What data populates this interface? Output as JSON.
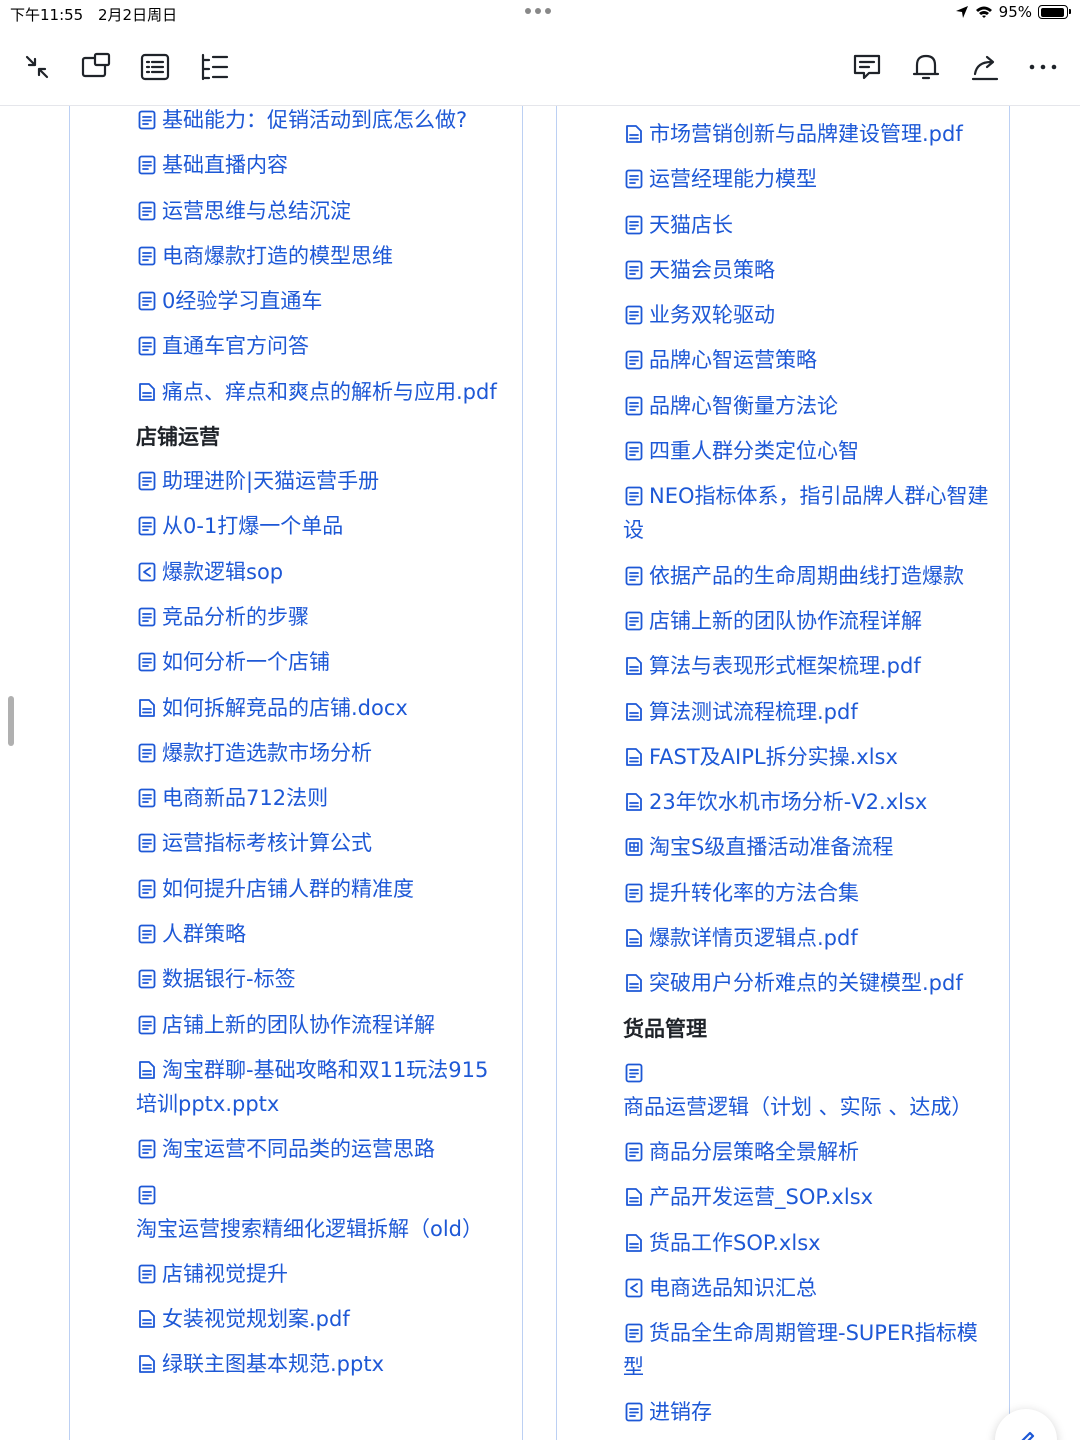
{
  "status": {
    "time": "下午11:55",
    "date": "2月2日周日",
    "battery": "95%",
    "battery_level": 0.95
  },
  "toolbar": {
    "left_icons": [
      "collapse-icon",
      "window-icon",
      "list-view-icon",
      "outline-icon"
    ],
    "right_icons": [
      "comment-icon",
      "bell-icon",
      "share-icon",
      "more-icon"
    ]
  },
  "left_column": {
    "items_top": [
      {
        "label": "基础能力：促销活动到底怎么做?",
        "icon": "doc-icon"
      },
      {
        "label": "基础直播内容",
        "icon": "doc-icon"
      },
      {
        "label": "运营思维与总结沉淀",
        "icon": "doc-icon"
      },
      {
        "label": "电商爆款打造的模型思维",
        "icon": "doc-icon"
      },
      {
        "label": "0经验学习直通车",
        "icon": "doc-icon"
      },
      {
        "label": "直通车官方问答",
        "icon": "doc-icon"
      },
      {
        "label": "痛点、痒点和爽点的解析与应用.pdf",
        "icon": "file-icon"
      }
    ],
    "section_title": "店铺运营",
    "items_section": [
      {
        "label": "助理进阶|天猫运营手册",
        "icon": "doc-icon"
      },
      {
        "label": "从0-1打爆一个单品",
        "icon": "doc-icon"
      },
      {
        "label": "爆款逻辑sop",
        "icon": "mindmap-icon"
      },
      {
        "label": "竞品分析的步骤",
        "icon": "doc-icon"
      },
      {
        "label": "如何分析一个店铺",
        "icon": "doc-icon"
      },
      {
        "label": "如何拆解竞品的店铺.docx",
        "icon": "file-icon"
      },
      {
        "label": "爆款打造选款市场分析",
        "icon": "doc-icon"
      },
      {
        "label": "电商新品712法则",
        "icon": "doc-icon"
      },
      {
        "label": "运营指标考核计算公式",
        "icon": "doc-icon"
      },
      {
        "label": "如何提升店铺人群的精准度",
        "icon": "doc-icon"
      },
      {
        "label": "人群策略",
        "icon": "doc-icon"
      },
      {
        "label": "数据银行-标签",
        "icon": "doc-icon"
      },
      {
        "label": "店铺上新的团队协作流程详解",
        "icon": "doc-icon"
      },
      {
        "label": "淘宝群聊-基础攻略和双11玩法915培训pptx.pptx",
        "icon": "file-icon"
      },
      {
        "label": "淘宝运营不同品类的运营思路",
        "icon": "doc-icon"
      },
      {
        "label": "淘宝运营搜索精细化逻辑拆解（old）",
        "icon": "doc-icon"
      },
      {
        "label": "店铺视觉提升",
        "icon": "doc-icon"
      },
      {
        "label": "女装视觉规划案.pdf",
        "icon": "file-icon"
      },
      {
        "label": "绿联主图基本规范.pptx",
        "icon": "file-icon"
      }
    ]
  },
  "right_column": {
    "items_top": [
      {
        "label": "市场营销创新与品牌建设管理.pdf",
        "icon": "file-icon"
      },
      {
        "label": "运营经理能力模型",
        "icon": "doc-icon"
      },
      {
        "label": "天猫店长",
        "icon": "doc-icon"
      },
      {
        "label": "天猫会员策略",
        "icon": "doc-icon"
      },
      {
        "label": "业务双轮驱动",
        "icon": "doc-icon"
      },
      {
        "label": "品牌心智运营策略",
        "icon": "doc-icon"
      },
      {
        "label": "品牌心智衡量方法论",
        "icon": "doc-icon"
      },
      {
        "label": "四重人群分类定位心智",
        "icon": "doc-icon"
      },
      {
        "label": "NEO指标体系，指引品牌人群心智建设",
        "icon": "doc-icon"
      },
      {
        "label": "依据产品的生命周期曲线打造爆款",
        "icon": "doc-icon"
      },
      {
        "label": "店铺上新的团队协作流程详解",
        "icon": "doc-icon"
      },
      {
        "label": "算法与表现形式框架梳理.pdf",
        "icon": "file-icon"
      },
      {
        "label": "算法测试流程梳理.pdf",
        "icon": "file-icon"
      },
      {
        "label": "FAST及AIPL拆分实操.xlsx",
        "icon": "file-icon"
      },
      {
        "label": "23年饮水机市场分析-V2.xlsx",
        "icon": "file-icon"
      },
      {
        "label": "淘宝S级直播活动准备流程",
        "icon": "table-icon"
      },
      {
        "label": "提升转化率的方法合集",
        "icon": "doc-icon"
      },
      {
        "label": "爆款详情页逻辑点.pdf",
        "icon": "file-icon"
      },
      {
        "label": "突破用户分析难点的关键模型.pdf",
        "icon": "file-icon"
      }
    ],
    "section_title": "货品管理",
    "items_section": [
      {
        "label": "商品运营逻辑（计划 、实际 、达成）",
        "icon": "doc-icon"
      },
      {
        "label": "商品分层策略全景解析",
        "icon": "doc-icon"
      },
      {
        "label": "产品开发运营_SOP.xlsx",
        "icon": "file-icon"
      },
      {
        "label": "货品工作SOP.xlsx",
        "icon": "file-icon"
      },
      {
        "label": "电商选品知识汇总",
        "icon": "mindmap-icon"
      },
      {
        "label": "货品全生命周期管理-SUPER指标模型",
        "icon": "doc-icon"
      },
      {
        "label": "进销存",
        "icon": "doc-icon"
      }
    ]
  },
  "fab": {
    "icon": "edit-icon"
  },
  "colors": {
    "link": "#1d58d6",
    "border": "#bcd0f3",
    "text": "#1f2329"
  }
}
